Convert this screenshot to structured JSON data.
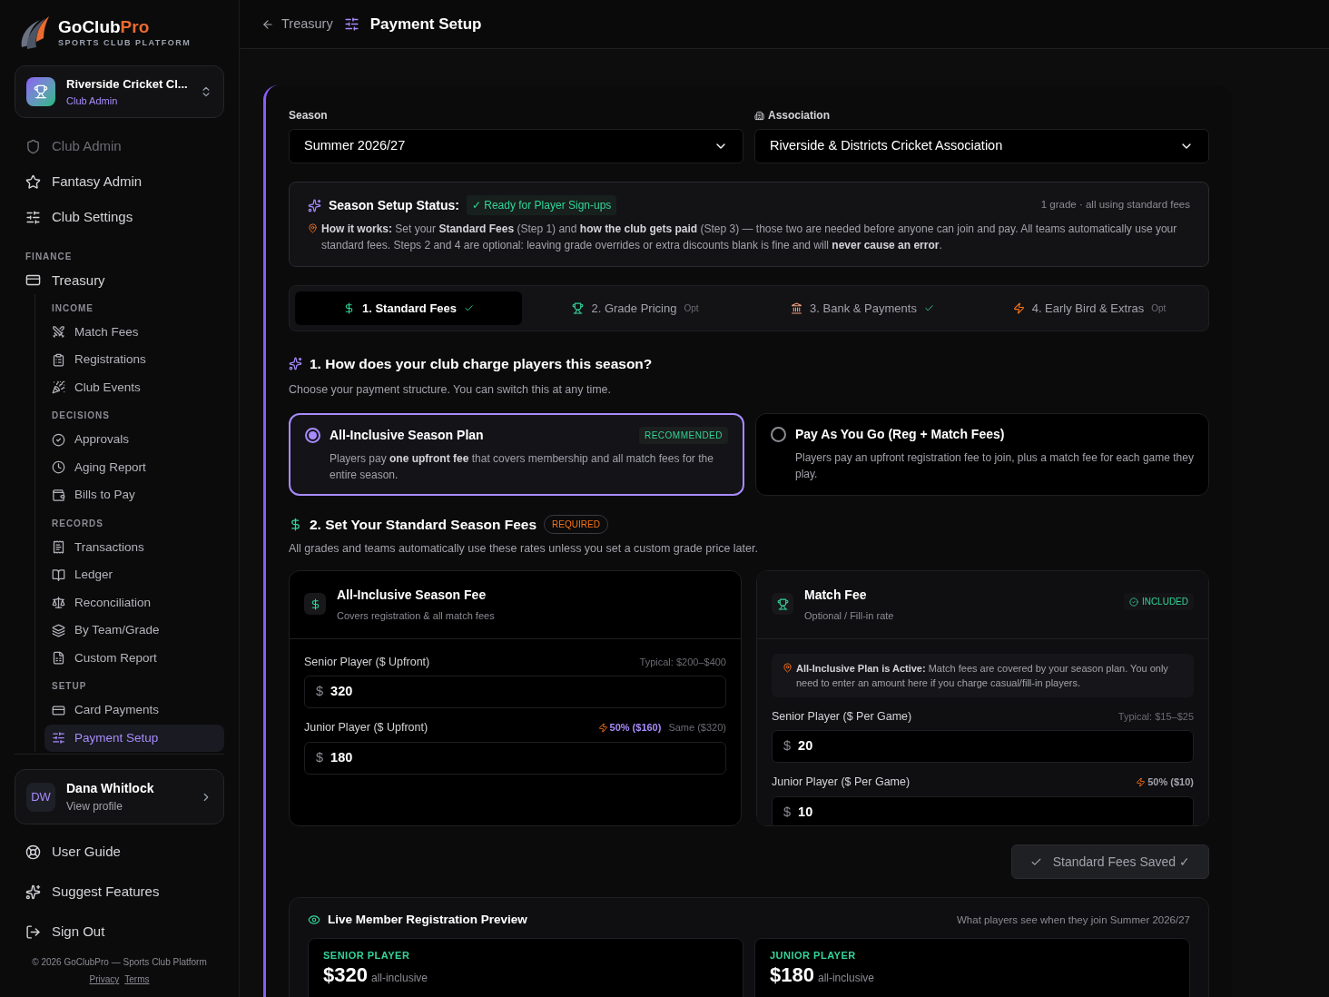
{
  "brand": {
    "name": "GoClub",
    "name_accent": "Pro",
    "tagline": "SPORTS CLUB PLATFORM"
  },
  "club": {
    "name": "Riverside Cricket Cl...",
    "role": "Club Admin"
  },
  "top_nav": [
    {
      "label": "Club Admin",
      "disabled": true
    },
    {
      "label": "Fantasy Admin",
      "disabled": false
    },
    {
      "label": "Club Settings",
      "disabled": false
    }
  ],
  "finance": {
    "label": "FINANCE",
    "item": "Treasury",
    "groups": [
      {
        "label": "INCOME",
        "items": [
          {
            "label": "Match Fees",
            "selected": false
          },
          {
            "label": "Registrations",
            "selected": false
          },
          {
            "label": "Club Events",
            "selected": false
          }
        ]
      },
      {
        "label": "DECISIONS",
        "items": [
          {
            "label": "Approvals",
            "selected": false
          },
          {
            "label": "Aging Report",
            "selected": false
          },
          {
            "label": "Bills to Pay",
            "selected": false
          }
        ]
      },
      {
        "label": "RECORDS",
        "items": [
          {
            "label": "Transactions",
            "selected": false
          },
          {
            "label": "Ledger",
            "selected": false
          },
          {
            "label": "Reconciliation",
            "selected": false
          },
          {
            "label": "By Team/Grade",
            "selected": false
          },
          {
            "label": "Custom Report",
            "selected": false
          }
        ]
      },
      {
        "label": "SETUP",
        "items": [
          {
            "label": "Card Payments",
            "selected": false
          },
          {
            "label": "Payment Setup",
            "selected": true
          }
        ]
      }
    ]
  },
  "user": {
    "initials": "DW",
    "name": "Dana Whitlock",
    "link": "View profile"
  },
  "bottom_nav": [
    "User Guide",
    "Suggest Features",
    "Sign Out"
  ],
  "footer": {
    "copyright": "© 2026 GoClubPro — Sports Club Platform",
    "links": [
      "Privacy",
      "Terms"
    ]
  },
  "header": {
    "back": "Treasury",
    "title": "Payment Setup"
  },
  "season": {
    "label": "Season",
    "value": "Summer 2026/27"
  },
  "association": {
    "label": "Association",
    "value": "Riverside & Districts Cricket Association"
  },
  "status": {
    "title": "Season Setup Status:",
    "badge": "✓ Ready for Player Sign-ups",
    "meta": "1 grade · all using standard fees",
    "text": "**How it works:** Set your **Standard Fees** (Step 1) and **how the club gets paid** (Step 3) — those two are needed before anyone can join and pay. All teams automatically use your standard fees. Steps 2 and 4 are optional: leaving grade overrides or extra discounts blank is fine and will **never cause an error**."
  },
  "steps": [
    {
      "label": "1. Standard Fees",
      "selected": true,
      "done": true
    },
    {
      "label": "2. Grade Pricing",
      "selected": false,
      "done": false,
      "tag": "Opt"
    },
    {
      "label": "3. Bank & Payments",
      "selected": false,
      "done": true
    },
    {
      "label": "4. Early Bird & Extras",
      "selected": false,
      "done": false,
      "tag": "Opt"
    }
  ],
  "section_1": {
    "title": "1. How does your club charge players this season?",
    "subtitle": "Choose your payment structure. You can switch this at any time."
  },
  "plans": [
    {
      "title": "All-Inclusive Season Plan",
      "badge": "RECOMMENDED",
      "description": "Players pay **one upfront fee** that covers membership and all match fees for the entire season.",
      "selected": true
    },
    {
      "title": "Pay As You Go (Reg + Match Fees)",
      "description": "Players pay an upfront registration fee to join, plus a match fee for each game they play.",
      "selected": false
    }
  ],
  "section_2": {
    "title": "2. Set Your Standard Season Fees",
    "badge": "REQUIRED",
    "subtitle": "All grades and teams automatically use these rates unless you set a custom grade price later."
  },
  "fee_cards": [
    {
      "title": "All-Inclusive Season Fee",
      "subtitle": "Covers registration & all match fees",
      "fields": [
        {
          "label": "Senior Player ($ Upfront)",
          "hints": [
            {
              "kind": "plain",
              "text": "Typical: $200–$400"
            }
          ],
          "currency": "$",
          "value": "320"
        },
        {
          "label": "Junior Player ($ Upfront)",
          "hints": [
            {
              "kind": "discount",
              "text": "50% ($160)"
            },
            {
              "kind": "plain",
              "text": "Same ($320)"
            }
          ],
          "currency": "$",
          "value": "180"
        }
      ]
    },
    {
      "title": "Match Fee",
      "subtitle": "Optional / Fill-in rate",
      "badge": "INCLUDED",
      "note": "**All-Inclusive Plan is Active:** Match fees are covered by your season plan. You only need to enter an amount here if you charge casual/fill-in players.",
      "fields": [
        {
          "label": "Senior Player ($ Per Game)",
          "hints": [
            {
              "kind": "plain",
              "text": "Typical: $15–$25"
            }
          ],
          "currency": "$",
          "value": "20"
        },
        {
          "label": "Junior Player ($ Per Game)",
          "hints": [
            {
              "kind": "discount",
              "text": "50% ($10)"
            }
          ],
          "currency": "$",
          "value": "10"
        }
      ]
    }
  ],
  "save_button": "Standard Fees Saved ✓",
  "preview": {
    "title": "Live Member Registration Preview",
    "meta": "What players see when they join Summer 2026/27",
    "cards": [
      {
        "label": "SENIOR PLAYER",
        "price": "$320",
        "suffix": "all-inclusive"
      },
      {
        "label": "JUNIOR PLAYER",
        "price": "$180",
        "suffix": "all-inclusive"
      }
    ]
  }
}
